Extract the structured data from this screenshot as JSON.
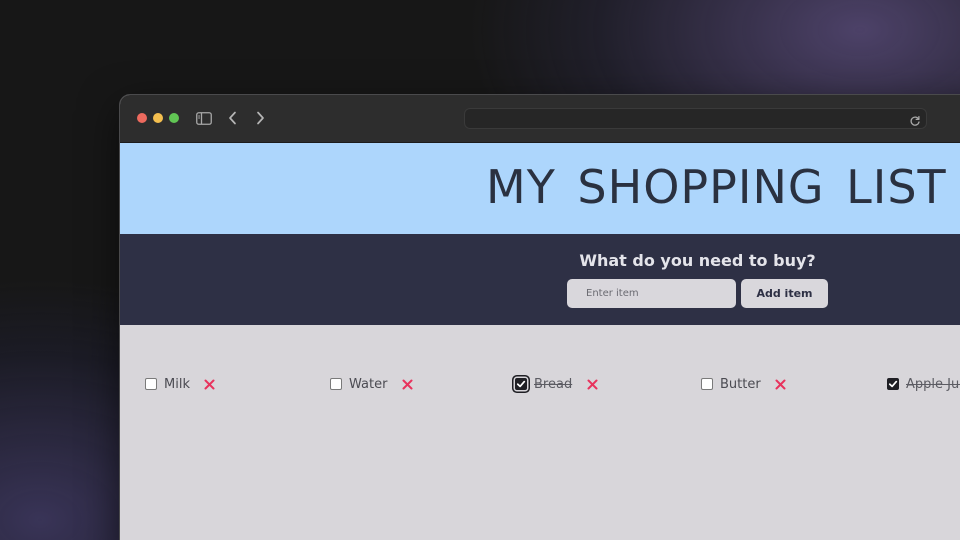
{
  "app": {
    "title": "MY SHOPPING LIST",
    "prompt": "What do you need to buy?"
  },
  "form": {
    "placeholder": "Enter item",
    "value": "",
    "add_label": "Add item"
  },
  "items": [
    {
      "label": "Milk",
      "checked": false
    },
    {
      "label": "Water",
      "checked": false
    },
    {
      "label": "Bread",
      "checked": true
    },
    {
      "label": "Butter",
      "checked": false
    },
    {
      "label": "Apple Juice",
      "checked": true
    }
  ],
  "icons": {
    "checkbox": "checkbox-icon",
    "delete": "close-icon",
    "sidebar": "sidebar-icon",
    "back": "chevron-left-icon",
    "forward": "chevron-right-icon",
    "reload": "reload-icon"
  },
  "colors": {
    "hero_bg": "#add6fc",
    "title_text": "#2a3140",
    "form_bg": "#2e3045",
    "list_bg": "#d8d6da",
    "delete_x": "#e8335d",
    "checked_box": "#1f1f24"
  }
}
